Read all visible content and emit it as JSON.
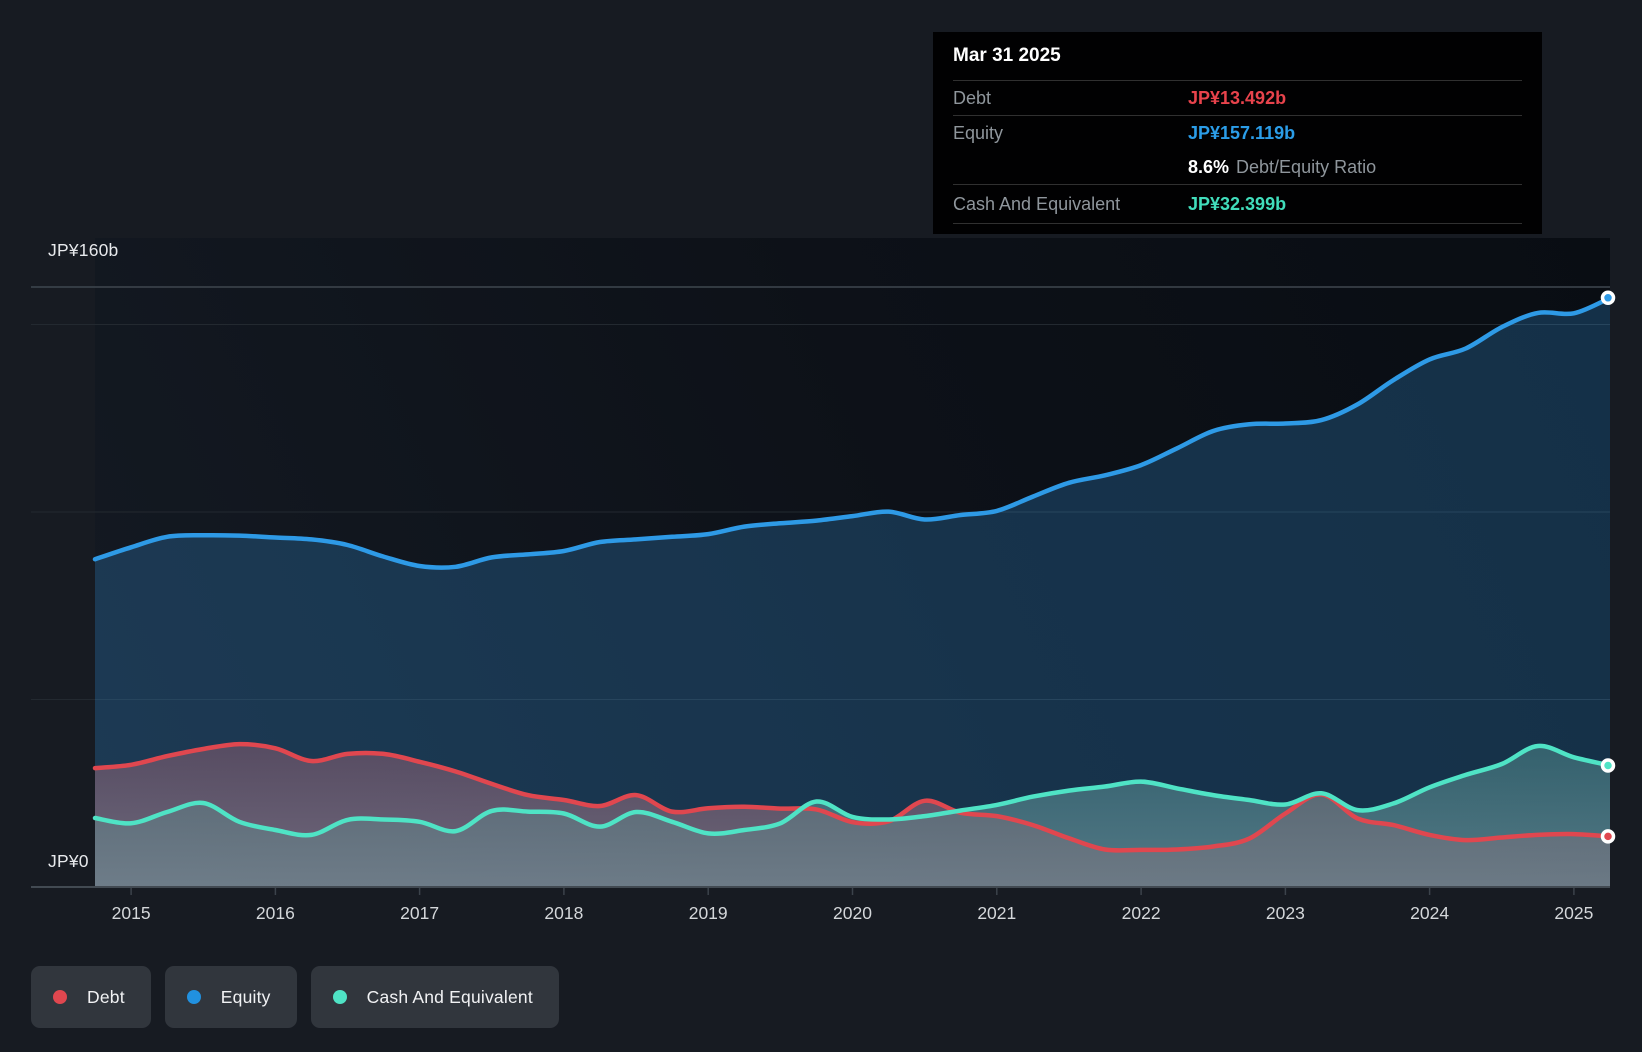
{
  "tooltip": {
    "date": "Mar 31 2025",
    "debt_label": "Debt",
    "debt_value": "JP¥13.492b",
    "equity_label": "Equity",
    "equity_value": "JP¥157.119b",
    "ratio_value": "8.6%",
    "ratio_label": "Debt/Equity Ratio",
    "cash_label": "Cash And Equivalent",
    "cash_value": "JP¥32.399b"
  },
  "axis": {
    "y_max_label": "JP¥160b",
    "y_zero_label": "JP¥0",
    "years": [
      "2015",
      "2016",
      "2017",
      "2018",
      "2019",
      "2020",
      "2021",
      "2022",
      "2023",
      "2024",
      "2025"
    ]
  },
  "legend": [
    {
      "label": "Debt",
      "color": "#e0474f"
    },
    {
      "label": "Equity",
      "color": "#2191e0"
    },
    {
      "label": "Cash And Equivalent",
      "color": "#4fe3c5"
    }
  ],
  "colors": {
    "debt": "#e8434c",
    "equity": "#2b9de8",
    "cash": "#41ddbb",
    "page_bg": "#171b22",
    "panel_bg": "#010102",
    "grid_faint": "#232930",
    "grid_bright": "#3f474f",
    "axis_line": "#424a52",
    "tick_label": "#d4d7da"
  },
  "chart_data": {
    "type": "area",
    "title": "Debt to Equity History and Analysis",
    "x_unit": "decimal_year",
    "xlim": [
      2014.75,
      2025.25
    ],
    "ylim": [
      0,
      160
    ],
    "y_gridlines_b": [
      50,
      100,
      150,
      160
    ],
    "x_ticks": [
      2015,
      2016,
      2017,
      2018,
      2019,
      2020,
      2021,
      2022,
      2023,
      2024,
      2025
    ],
    "legend_position": "bottom-left",
    "x": [
      2014.75,
      2015.0,
      2015.25,
      2015.5,
      2015.75,
      2016.0,
      2016.25,
      2016.5,
      2016.75,
      2017.0,
      2017.25,
      2017.5,
      2017.75,
      2018.0,
      2018.25,
      2018.5,
      2018.75,
      2019.0,
      2019.25,
      2019.5,
      2019.75,
      2020.0,
      2020.25,
      2020.5,
      2020.75,
      2021.0,
      2021.25,
      2021.5,
      2021.75,
      2022.0,
      2022.25,
      2022.5,
      2022.75,
      2023.0,
      2023.25,
      2023.5,
      2023.75,
      2024.0,
      2024.25,
      2024.5,
      2024.75,
      2025.0,
      2025.25
    ],
    "series": [
      {
        "name": "Equity",
        "color": "#2e9ae6",
        "values": [
          87.4,
          90.6,
          93.4,
          93.8,
          93.7,
          93.2,
          92.7,
          91.2,
          88.1,
          85.6,
          85.4,
          87.9,
          88.7,
          89.6,
          92.0,
          92.7,
          93.4,
          94.1,
          96.1,
          97.0,
          97.7,
          98.9,
          100.1,
          98.0,
          99.2,
          100.3,
          104.1,
          107.8,
          109.8,
          112.5,
          117.0,
          121.6,
          123.4,
          123.6,
          124.5,
          128.7,
          135.2,
          140.7,
          143.6,
          149.3,
          153.1,
          153.0,
          157.119
        ]
      },
      {
        "name": "Debt",
        "color": "#e0474f",
        "values": [
          31.7,
          32.6,
          34.9,
          36.8,
          38.1,
          37.0,
          33.6,
          35.5,
          35.5,
          33.4,
          30.8,
          27.5,
          24.5,
          23.2,
          21.6,
          24.5,
          20.1,
          21.0,
          21.4,
          20.9,
          20.7,
          17.3,
          17.5,
          23.0,
          19.8,
          18.9,
          16.5,
          13.0,
          10.0,
          9.9,
          10.0,
          10.8,
          12.9,
          19.6,
          24.7,
          18.3,
          16.5,
          13.9,
          12.5,
          13.2,
          13.9,
          14.1,
          13.492
        ]
      },
      {
        "name": "Cash And Equivalent",
        "color": "#4fe3c5",
        "values": [
          18.4,
          17.0,
          20.0,
          22.4,
          17.4,
          15.2,
          13.9,
          17.9,
          18.0,
          17.4,
          14.9,
          20.3,
          20.1,
          19.6,
          16.1,
          20.0,
          17.4,
          14.3,
          15.2,
          17.0,
          22.8,
          18.7,
          18.0,
          18.9,
          20.4,
          21.9,
          24.1,
          25.7,
          26.8,
          28.1,
          26.3,
          24.5,
          23.2,
          22.0,
          25.0,
          20.5,
          22.3,
          26.6,
          29.9,
          32.8,
          37.6,
          34.6,
          32.399
        ]
      }
    ],
    "end_values": {
      "Equity": 157.119,
      "Debt": 13.492,
      "Cash And Equivalent": 32.399
    }
  }
}
